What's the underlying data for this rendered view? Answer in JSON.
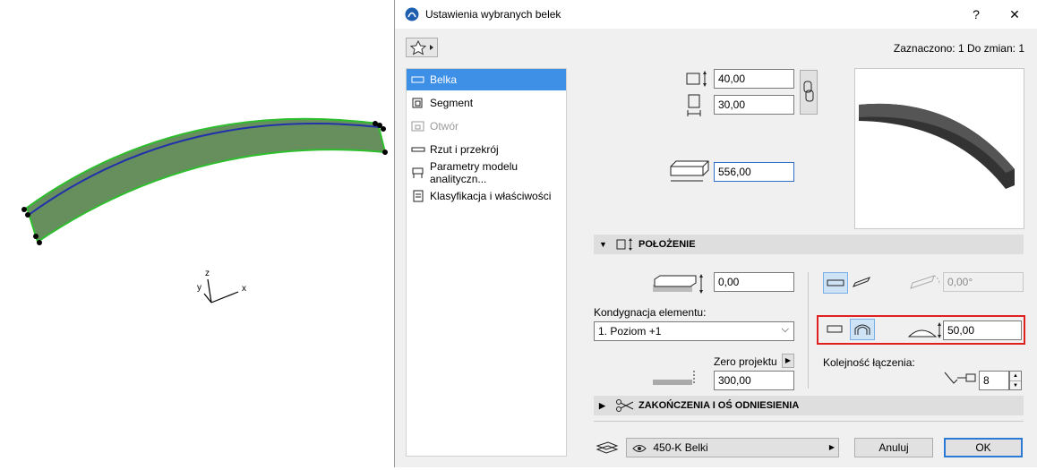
{
  "dialog": {
    "title": "Ustawienia wybranych belek",
    "help_label": "?",
    "close_label": "✕",
    "selection_info": "Zaznaczono: 1 Do zmian: 1"
  },
  "nav": {
    "items": [
      {
        "label": "Belka",
        "active": true
      },
      {
        "label": "Segment"
      },
      {
        "label": "Otwór",
        "disabled": true
      },
      {
        "label": "Rzut i przekrój"
      },
      {
        "label": "Parametry modelu analityczn..."
      },
      {
        "label": "Klasyfikacja i właściwości"
      }
    ]
  },
  "geometry": {
    "width": "40,00",
    "height": "30,00",
    "length": "556,00"
  },
  "positioning": {
    "header": "POŁOŻENIE",
    "offset": "0,00",
    "story_label": "Kondygnacja elementu:",
    "story_value": "1. Poziom +1",
    "ref_label": "Zero projektu",
    "ref_value": "300,00",
    "angle": "0,00°",
    "curve_height": "50,00",
    "order_label": "Kolejność łączenia:",
    "order_value": "8"
  },
  "ends": {
    "header": "ZAKOŃCZENIA I OŚ ODNIESIENIA"
  },
  "footer": {
    "layer": "450-K Belki",
    "cancel": "Anuluj",
    "ok": "OK"
  },
  "axes": {
    "x": "x",
    "y": "y",
    "z": "z"
  },
  "colors": {
    "accent": "#3e8fe6",
    "highlight": "#e02020",
    "beam_fill": "#5a8a50",
    "beam_edge": "#22bb22",
    "beam_axis": "#2233aa"
  }
}
